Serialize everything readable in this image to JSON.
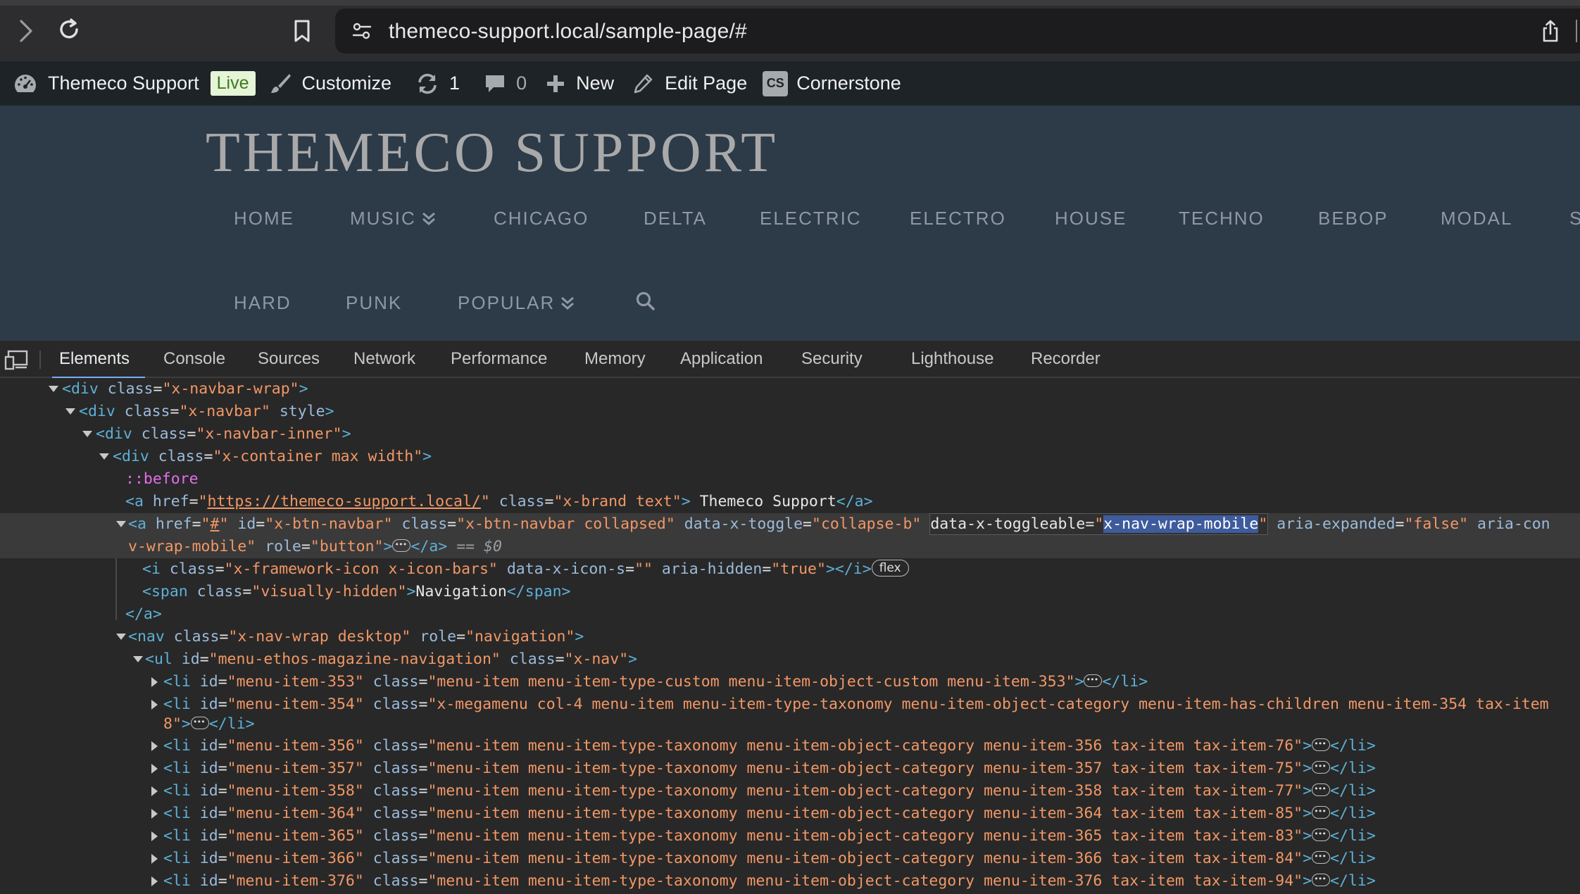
{
  "browser": {
    "url": "themeco-support.local/sample-page/#"
  },
  "admin_bar": {
    "site_name": "Themeco Support",
    "live_badge": "Live",
    "customize": "Customize",
    "updates_count": "1",
    "comments_count": "0",
    "new": "New",
    "edit_page": "Edit Page",
    "cs_badge": "CS",
    "cornerstone": "Cornerstone"
  },
  "site": {
    "title": "THEMECO SUPPORT",
    "nav_row1": [
      "HOME",
      "MUSIC",
      "CHICAGO",
      "DELTA",
      "ELECTRIC",
      "ELECTRO",
      "HOUSE",
      "TECHNO",
      "BEBOP",
      "MODAL",
      "S"
    ],
    "nav_row2": [
      "HARD",
      "PUNK",
      "POPULAR"
    ]
  },
  "devtools": {
    "tabs": [
      "Elements",
      "Console",
      "Sources",
      "Network",
      "Performance",
      "Memory",
      "Application",
      "Security",
      "Lighthouse",
      "Recorder"
    ],
    "active_tab": "Elements"
  },
  "dom": {
    "l1_tag": "div",
    "l1_class": "x-navbar-wrap",
    "l2_tag": "div",
    "l2_class": "x-navbar",
    "l2_attr2": "style",
    "l3_tag": "div",
    "l3_class": "x-navbar-inner",
    "l4_tag": "div",
    "l4_class": "x-container max width",
    "l5_pseudo": "::before",
    "l6_href": "https://themeco-support.local/",
    "l6_class": "x-brand text",
    "l6_text": " Themeco Support",
    "l7_href": "#",
    "l7_id": "x-btn-navbar",
    "l7_class": "x-btn-navbar collapsed",
    "l7_toggle": "collapse-b",
    "l7_toggleable": "x-nav-wrap-mobile",
    "l7_expanded": "false",
    "l7_tail": " aria-con",
    "l8_cont": "v-wrap-mobile",
    "l8_role": "button",
    "l8_eq": "== $0",
    "l9_class": "x-framework-icon x-icon-bars",
    "l9_icon": "",
    "l9_hidden": "true",
    "l9_badge": "flex",
    "l10_class": "visually-hidden",
    "l10_text": "Navigation",
    "l12_class": "x-nav-wrap desktop",
    "l12_role": "navigation",
    "l13_id": "menu-ethos-magazine-navigation",
    "l13_class": "x-nav",
    "items": [
      {
        "id": "menu-item-353",
        "cls": "menu-item menu-item-type-custom menu-item-object-custom menu-item-353"
      },
      {
        "id": "menu-item-354",
        "cls": "x-megamenu col-4 menu-item menu-item-type-taxonomy menu-item-object-category menu-item-has-children menu-item-354 tax-item",
        "cont": "8"
      },
      {
        "id": "menu-item-356",
        "cls": "menu-item menu-item-type-taxonomy menu-item-object-category menu-item-356 tax-item tax-item-76"
      },
      {
        "id": "menu-item-357",
        "cls": "menu-item menu-item-type-taxonomy menu-item-object-category menu-item-357 tax-item tax-item-75"
      },
      {
        "id": "menu-item-358",
        "cls": "menu-item menu-item-type-taxonomy menu-item-object-category menu-item-358 tax-item tax-item-77"
      },
      {
        "id": "menu-item-364",
        "cls": "menu-item menu-item-type-taxonomy menu-item-object-category menu-item-364 tax-item tax-item-85"
      },
      {
        "id": "menu-item-365",
        "cls": "menu-item menu-item-type-taxonomy menu-item-object-category menu-item-365 tax-item tax-item-83"
      },
      {
        "id": "menu-item-366",
        "cls": "menu-item menu-item-type-taxonomy menu-item-object-category menu-item-366 tax-item tax-item-84"
      },
      {
        "id": "menu-item-376",
        "cls": "menu-item menu-item-type-taxonomy menu-item-object-category menu-item-376 tax-item tax-item-94"
      }
    ]
  },
  "colors": {
    "header_bg": "#2d3a48",
    "admin_bar_bg": "#1d2327",
    "devtools_bg": "#282828",
    "tag": "#5db0d7",
    "attr_name": "#9bbbdc",
    "attr_value": "#f29766",
    "active_tab_underline": "#7cacf8"
  }
}
